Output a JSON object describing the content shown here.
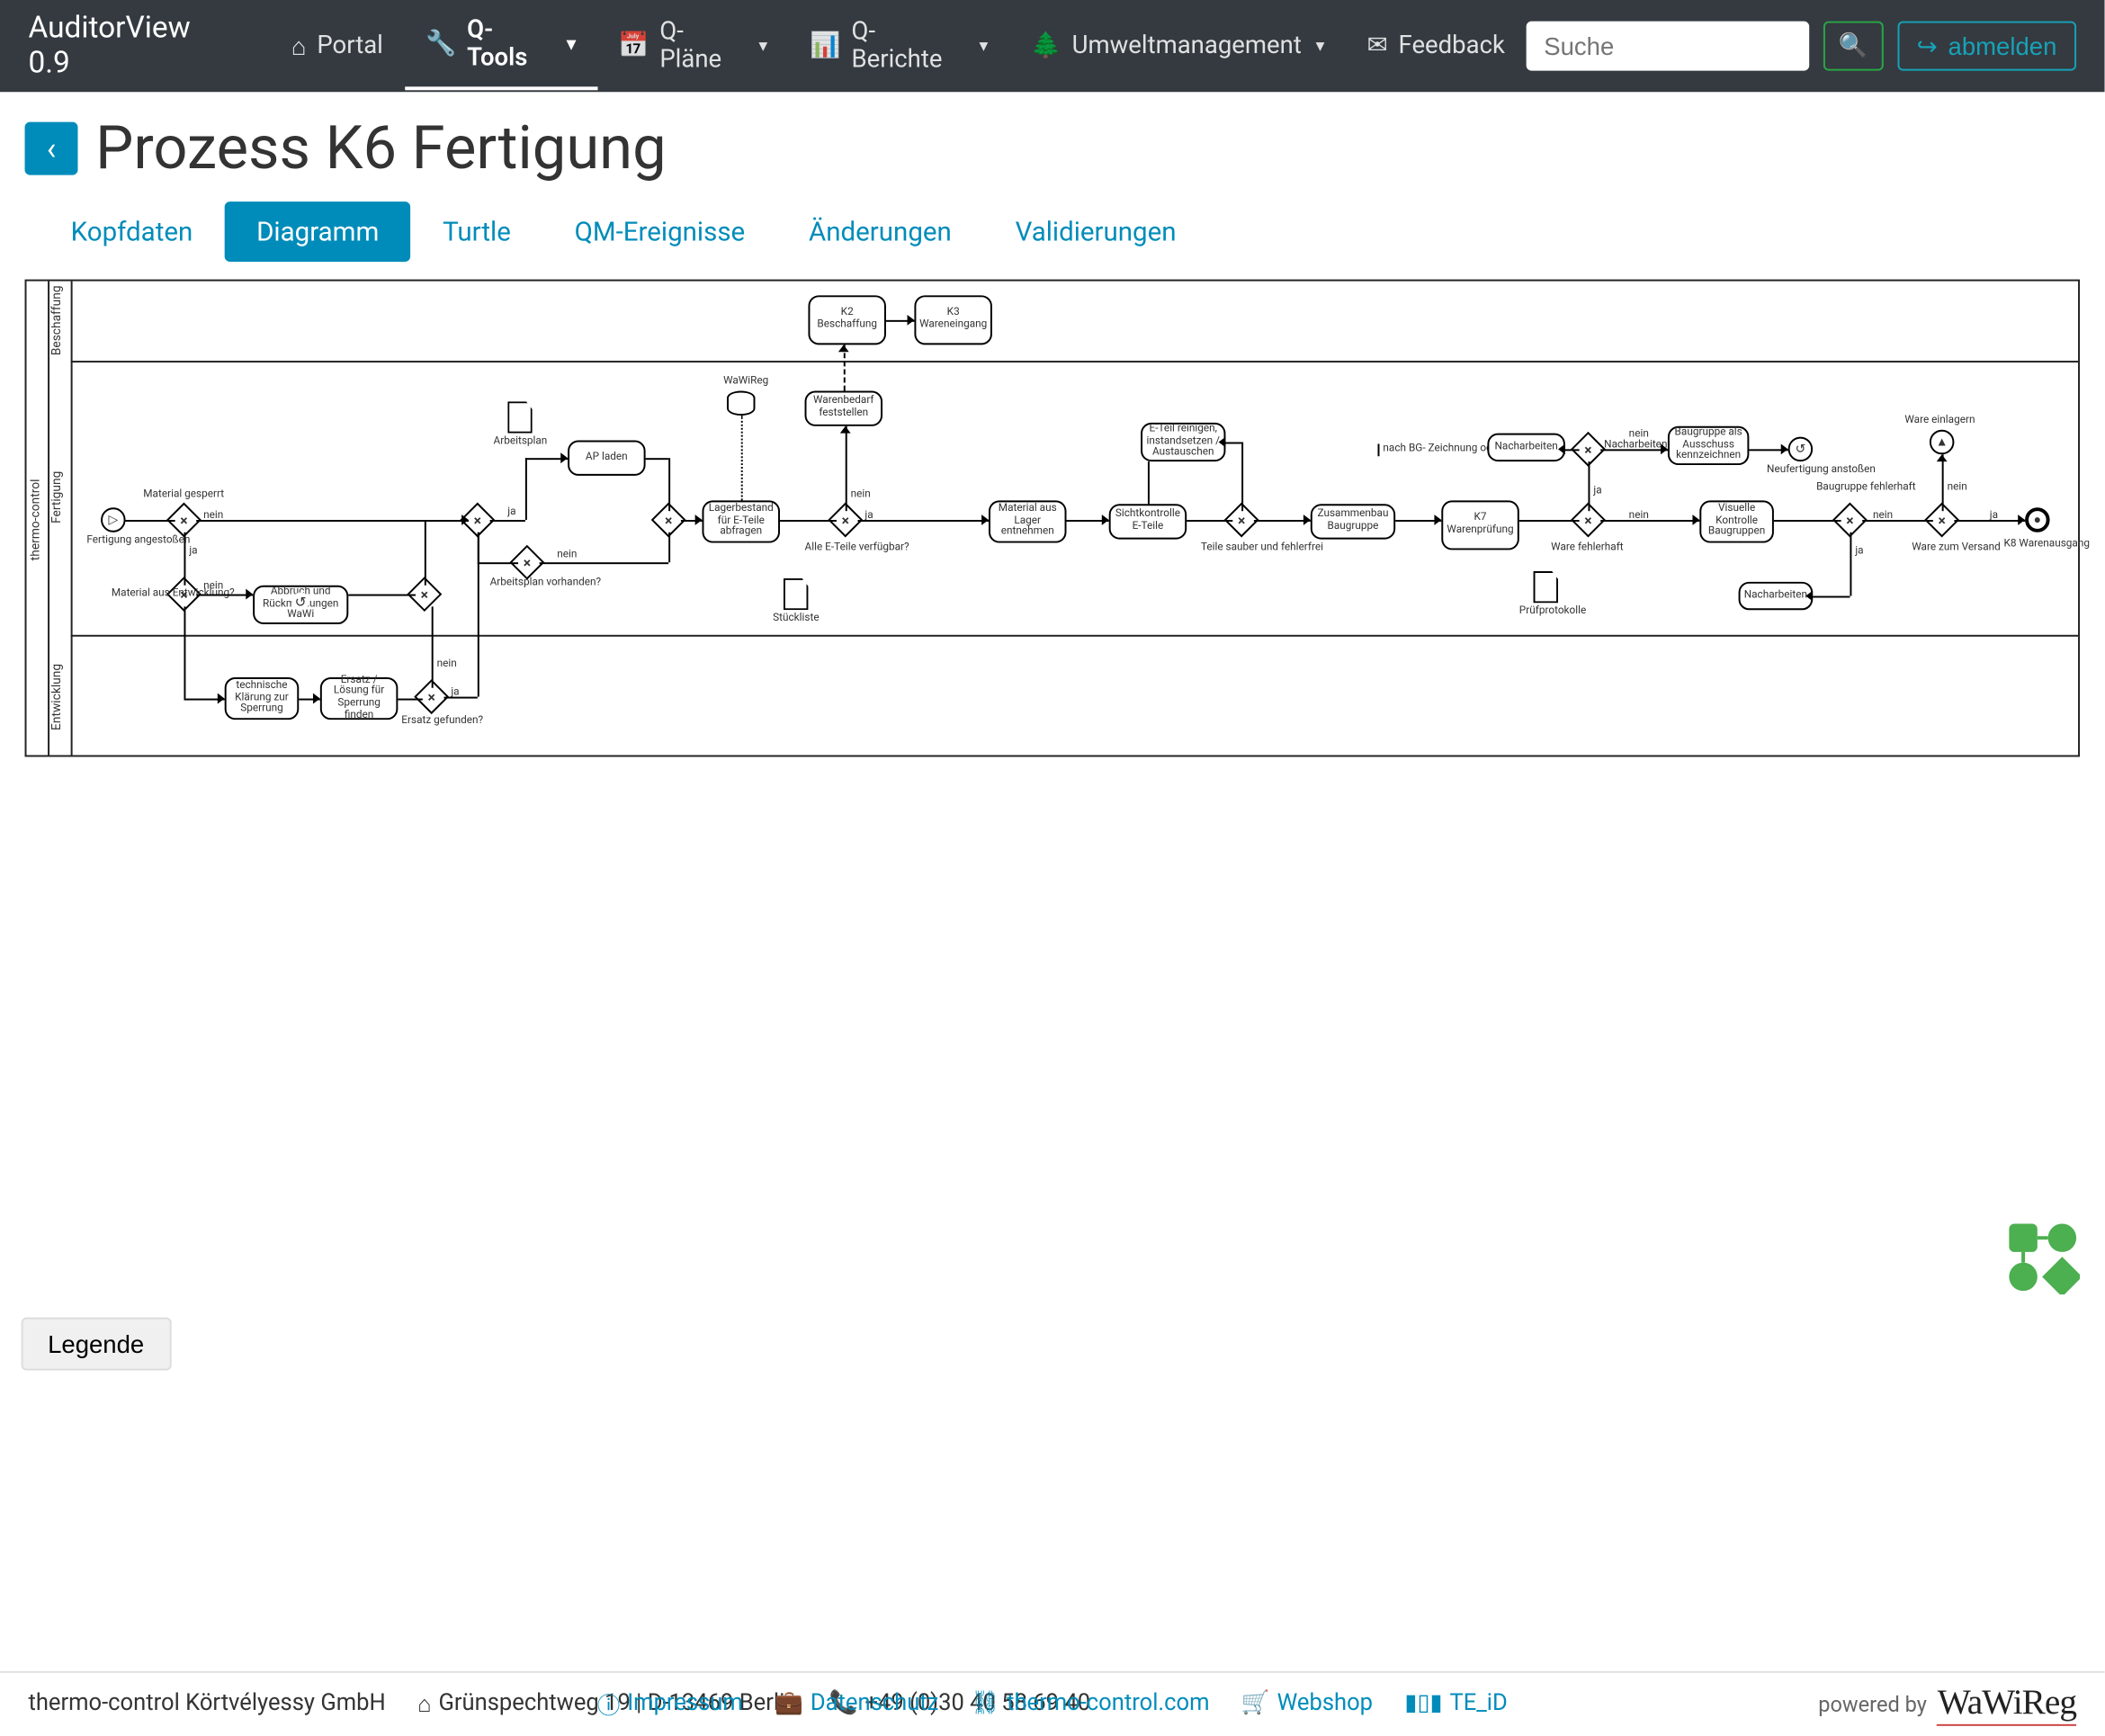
{
  "brand": "AuditorView 0.9",
  "nav": {
    "portal": "Portal",
    "qtools": "Q-Tools",
    "qplaene": "Q-Pläne",
    "qberichte": "Q-Berichte",
    "umwelt": "Umweltmanagement",
    "feedback": "Feedback"
  },
  "search": {
    "placeholder": "Suche"
  },
  "logout": "abmelden",
  "page": {
    "title": "Prozess K6 Fertigung"
  },
  "tabs": {
    "kopfdaten": "Kopfdaten",
    "diagramm": "Diagramm",
    "turtle": "Turtle",
    "qm": "QM-Ereignisse",
    "aenderungen": "Änderungen",
    "validierungen": "Validierungen"
  },
  "lanes": {
    "top": "Beschaffung",
    "mid": "Fertigung",
    "bottom": "Entwicklung",
    "pool": "thermo-control"
  },
  "diagram": {
    "subproc_k2": "K2\nBeschaffung",
    "subproc_k3": "K3\nWareneingang",
    "start_lbl": "Fertigung\nangestoßen",
    "gw_gesperrt": "Material gesperrt",
    "ja": "ja",
    "nein": "nein",
    "t_material_aus_entw": "Material aus\nEntwicklung?",
    "t_abbruch": "Abbruch und\nRückmeldungen\nWaWi",
    "t_tech_klaerung": "technische\nKlärung zur\nSperrung",
    "t_ersatz": "Ersatz / Lösung\nfür Sperrung\nfinden",
    "gw_ersatz": "Ersatz\ngefunden?",
    "data_arbeitsplan": "Arbeitsplan",
    "t_ap_laden": "AP laden",
    "gw_ap_vorhanden": "Arbeitsplan\nvorhanden?",
    "db_wawireg": "WaWiReg",
    "t_lagerbestand": "Lagerbestand\nfür E-Teile\nabfragen",
    "t_warenbedarf": "Warenbedarf\nfeststellen",
    "gw_eteile": "Alle E-Teile\nverfügbar?",
    "data_stueckliste": "Stückliste",
    "t_material_lager": "Material aus\nLager\nentnehmen",
    "t_sichtkontrolle": "Sichtkontrolle\nE-Teile",
    "t_reinigen": "E-Teil reinigen,\ninstandsetzen\n/ Austauschen",
    "gw_sauber": "Teile sauber und\nfehlerfrei",
    "t_zusammenbau": "Zusammenbau\nBaugruppe",
    "ann_nachbg": "nach BG-\nZeichnung oder\nArbeitsplan",
    "subproc_k7": "K7\nWarenprüfung",
    "t_nacharbeiten": "Nacharbeiten",
    "gw_fehlerhaft": "Ware fehlerhaft",
    "gw_nachmoeglich": "Nacharbeiten\nmöglich",
    "data_pruef": "Prüfprotokolle",
    "t_ausschuss": "Baugruppe als\nAusschuss\nkennzeichnen",
    "evt_neufertig": "Neufertigung\nanstoßen",
    "t_visuelle": "Visuelle\nKontrolle\nBaugruppen",
    "t_nacharbeiten2": "Nacharbeiten",
    "gw_bg_fehlerhaft": "Baugruppe\nfehlerhaft",
    "evt_einlagern": "Ware einlagern",
    "lbl_versand": "Ware zum\nVersand",
    "end_lbl": "K8\nWarenausgang"
  },
  "legend": "Legende",
  "footer": {
    "company": "thermo-control Körtvélyessy GmbH",
    "address": "Grünspechtweg 19 | D-13469 Berlin",
    "phone": "+49 (0)30 40 58 69 40",
    "impressum": "Impressum",
    "datenschutz": "Datenschutz",
    "domain": "thermo-control.com",
    "webshop": "Webshop",
    "teid": "TE_iD",
    "powered": "powered by",
    "poweredbrand": "WaWiReg"
  }
}
